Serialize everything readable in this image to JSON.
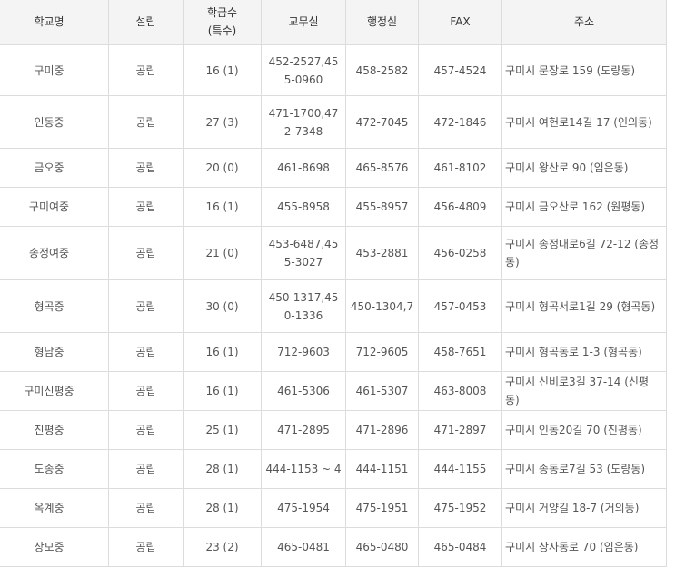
{
  "headers": {
    "name": "학교명",
    "founding": "설립",
    "classes_line1": "학급수",
    "classes_line2": "(특수)",
    "office": "교무실",
    "admin": "행정실",
    "fax": "FAX",
    "address": "주소"
  },
  "rows": [
    {
      "name": "구미중",
      "founding": "공립",
      "classes": "16 (1)",
      "office": "452-2527,455-0960",
      "admin": "458-2582",
      "fax": "457-4524",
      "address": "구미시 문장로 159 (도량동)"
    },
    {
      "name": "인동중",
      "founding": "공립",
      "classes": "27 (3)",
      "office": "471-1700,472-7348",
      "admin": "472-7045",
      "fax": "472-1846",
      "address": "구미시 여헌로14길 17 (인의동)"
    },
    {
      "name": "금오중",
      "founding": "공립",
      "classes": "20 (0)",
      "office": "461-8698",
      "admin": "465-8576",
      "fax": "461-8102",
      "address": "구미시 왕산로 90 (임은동)"
    },
    {
      "name": "구미여중",
      "founding": "공립",
      "classes": "16 (1)",
      "office": "455-8958",
      "admin": "455-8957",
      "fax": "456-4809",
      "address": "구미시 금오산로 162 (원평동)"
    },
    {
      "name": "송정여중",
      "founding": "공립",
      "classes": "21 (0)",
      "office": "453-6487,455-3027",
      "admin": "453-2881",
      "fax": "456-0258",
      "address": "구미시 송정대로6길 72-12 (송정동)"
    },
    {
      "name": "형곡중",
      "founding": "공립",
      "classes": "30 (0)",
      "office": "450-1317,450-1336",
      "admin": "450-1304,7",
      "fax": "457-0453",
      "address": "구미시 형곡서로1길 29 (형곡동)"
    },
    {
      "name": "형남중",
      "founding": "공립",
      "classes": "16 (1)",
      "office": "712-9603",
      "admin": "712-9605",
      "fax": "458-7651",
      "address": "구미시 형곡동로 1-3 (형곡동)"
    },
    {
      "name": "구미신평중",
      "founding": "공립",
      "classes": "16 (1)",
      "office": "461-5306",
      "admin": "461-5307",
      "fax": "463-8008",
      "address": "구미시 신비로3길 37-14 (신평동)"
    },
    {
      "name": "진평중",
      "founding": "공립",
      "classes": "25 (1)",
      "office": "471-2895",
      "admin": "471-2896",
      "fax": "471-2897",
      "address": "구미시 인동20길 70 (진평동)"
    },
    {
      "name": "도송중",
      "founding": "공립",
      "classes": "28 (1)",
      "office": "444-1153 ~ 4",
      "admin": "444-1151",
      "fax": "444-1155",
      "address": "구미시 송동로7길 53 (도량동)"
    },
    {
      "name": "옥계중",
      "founding": "공립",
      "classes": "28 (1)",
      "office": "475-1954",
      "admin": "475-1951",
      "fax": "475-1952",
      "address": "구미시 거양길 18-7 (거의동)"
    },
    {
      "name": "상모중",
      "founding": "공립",
      "classes": "23 (2)",
      "office": "465-0481",
      "admin": "465-0480",
      "fax": "465-0484",
      "address": "구미시 상사동로 70 (임은동)"
    }
  ]
}
